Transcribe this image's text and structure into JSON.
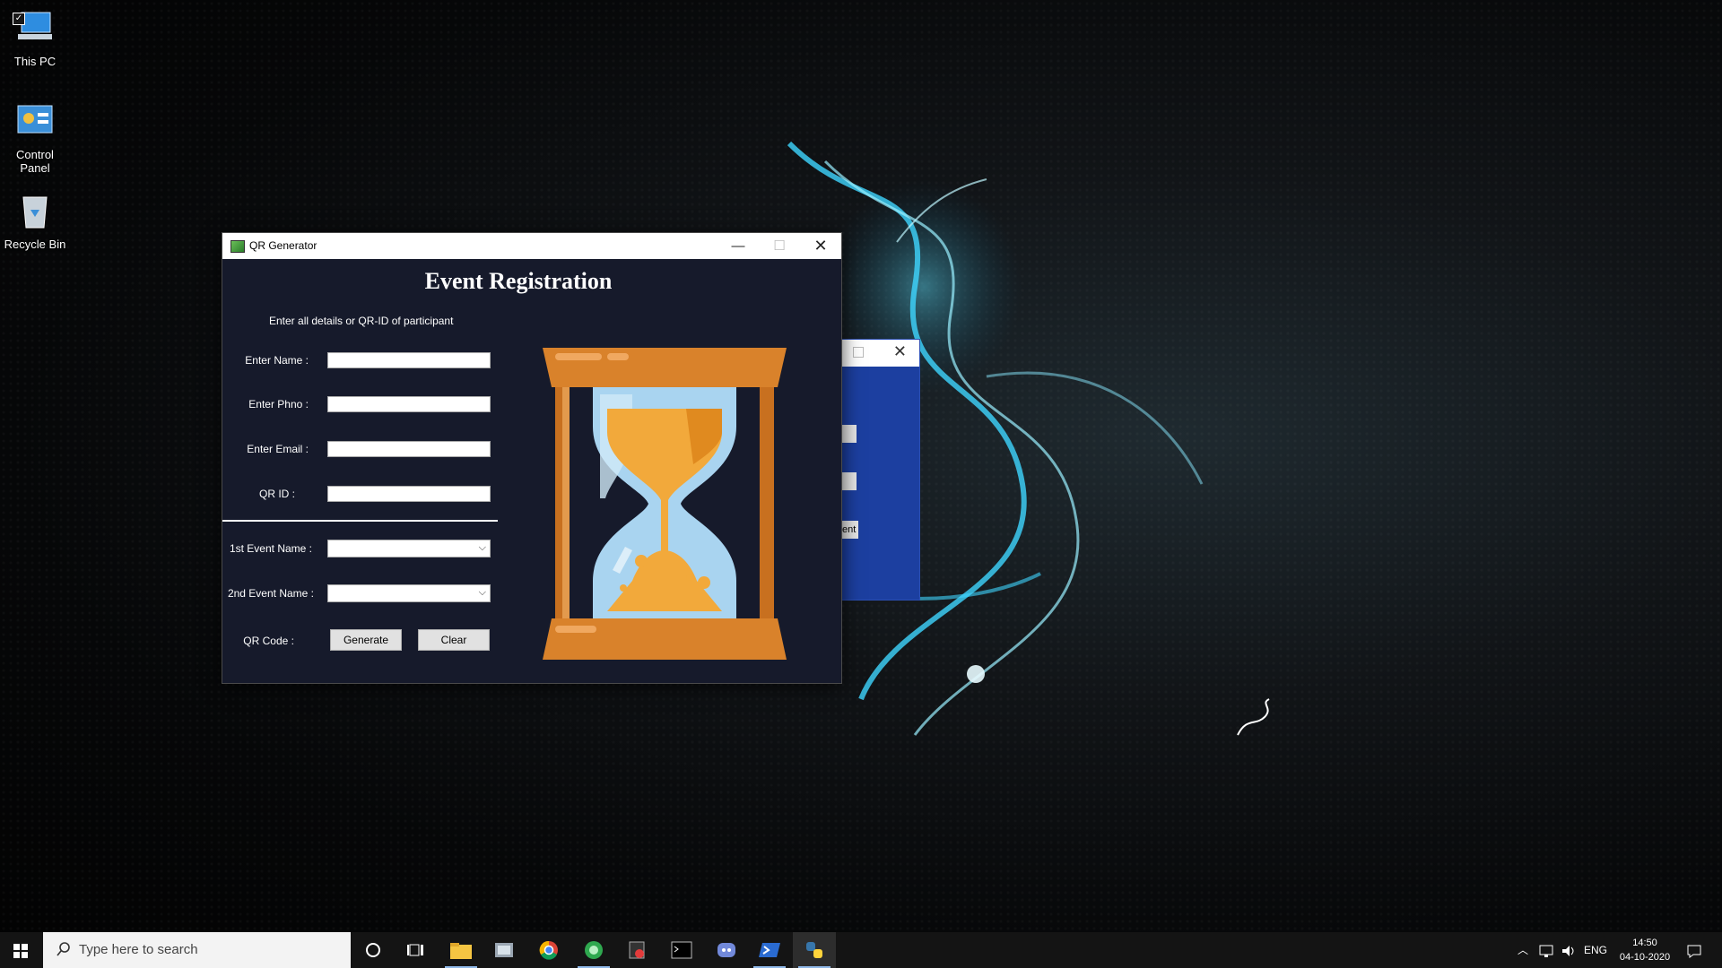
{
  "desktop": {
    "icons": [
      {
        "label": "This PC",
        "icon": "computer-icon"
      },
      {
        "label": "Control Panel",
        "icon": "control-panel-icon"
      },
      {
        "label": "Recycle Bin",
        "icon": "recycle-bin-icon"
      }
    ]
  },
  "window": {
    "title": "QR Generator",
    "heading": "Event Registration",
    "instruction": "Enter all details or QR-ID of participant",
    "fields": {
      "name_label": "Enter Name :",
      "name_value": "",
      "phone_label": "Enter Phno :",
      "phone_value": "",
      "email_label": "Enter Email :",
      "email_value": "",
      "qrid_label": "QR ID :",
      "qrid_value": "",
      "event1_label": "1st Event Name :",
      "event1_value": "",
      "event2_label": "2nd Event Name :",
      "event2_value": ""
    },
    "qr_code_label": "QR Code :",
    "generate_button": "Generate",
    "clear_button": "Clear",
    "image": "hourglass-icon"
  },
  "background_window": {
    "partial_button_text": "ent"
  },
  "taskbar": {
    "search_placeholder": "Type here to search",
    "pinned": [
      "cortana-icon",
      "task-view-icon",
      "file-explorer-icon",
      "settings-icon",
      "chrome-icon",
      "app-icon",
      "media-icon",
      "terminal-icon",
      "discord-icon",
      "powershell-icon",
      "python-icon"
    ],
    "language": "ENG",
    "time": "14:50",
    "date": "04-10-2020"
  },
  "colors": {
    "window_bg": "#161a2b",
    "bg_window_blue": "#1c3fa0",
    "hourglass_wood": "#d9822b",
    "hourglass_glass": "#a9d4f0",
    "hourglass_sand": "#f2a93b"
  }
}
